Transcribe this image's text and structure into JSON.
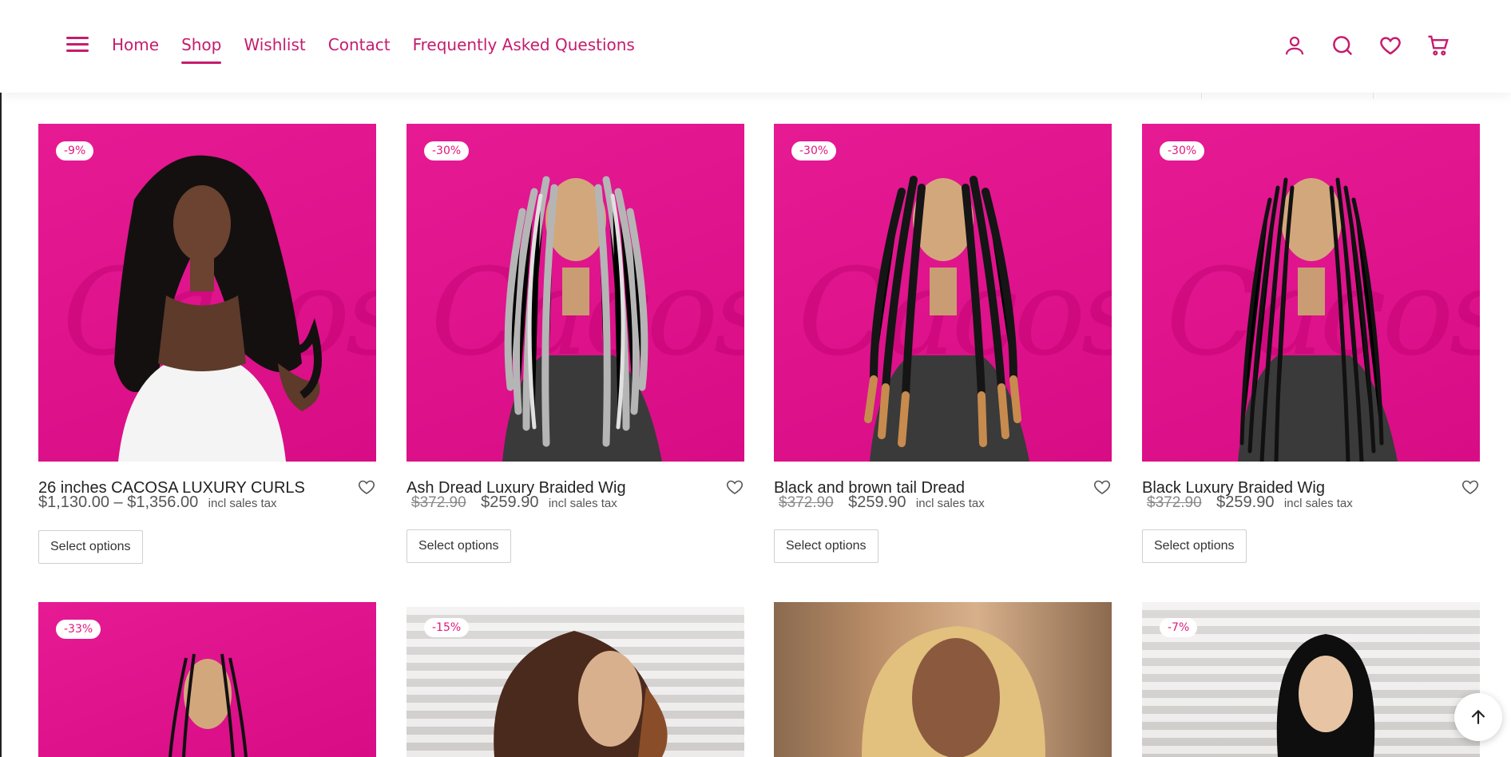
{
  "header": {
    "nav": [
      {
        "label": "Home",
        "active": false
      },
      {
        "label": "Shop",
        "active": true
      },
      {
        "label": "Wishlist",
        "active": false
      },
      {
        "label": "Contact",
        "active": false
      },
      {
        "label": "Frequently Asked Questions",
        "active": false
      }
    ],
    "icons": [
      "account-icon",
      "search-icon",
      "heart-icon",
      "cart-icon"
    ],
    "accent_color": "#c51c6e"
  },
  "products": [
    {
      "badge": "-9%",
      "title": "26 inches CACOSA LUXURY CURLS",
      "price_range": "$1,130.00 – $1,356.00",
      "old_price": "",
      "price": "",
      "tax": "incl sales tax",
      "button": "Select options"
    },
    {
      "badge": "-30%",
      "title": "Ash Dread Luxury Braided Wig",
      "price_range": "",
      "old_price": "$372.90",
      "price": "$259.90",
      "tax": "incl sales tax",
      "button": "Select options"
    },
    {
      "badge": "-30%",
      "title": "Black and brown tail Dread",
      "price_range": "",
      "old_price": "$372.90",
      "price": "$259.90",
      "tax": "incl sales tax",
      "button": "Select options"
    },
    {
      "badge": "-30%",
      "title": "Black Luxury Braided Wig",
      "price_range": "",
      "old_price": "$372.90",
      "price": "$259.90",
      "tax": "incl sales tax",
      "button": "Select options"
    }
  ],
  "row2_badges": [
    "-33%",
    "-15%",
    "",
    "-7%"
  ],
  "watermark_text": "Cacosa",
  "brand_pink": "#e0197d"
}
